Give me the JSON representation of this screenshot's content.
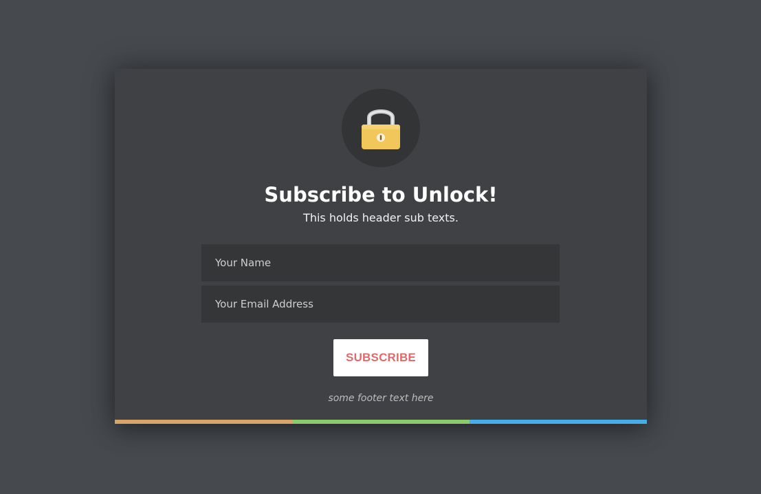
{
  "modal": {
    "title": "Subscribe to Unlock!",
    "subtitle": "This holds header sub texts.",
    "lock_icon": "padlock-icon",
    "form": {
      "name_placeholder": "Your Name",
      "email_placeholder": "Your Email Address",
      "submit_label": "SUBSCRIBE"
    },
    "footer_text": "some footer text here",
    "accent_colors": [
      "#d8a46a",
      "#8cc96a",
      "#45aee8"
    ]
  },
  "colors": {
    "page_background": "#46494e",
    "modal_background": "#404144",
    "field_background": "#353638",
    "button_text": "#e06a6a",
    "lock_body": "#f1c75b"
  }
}
